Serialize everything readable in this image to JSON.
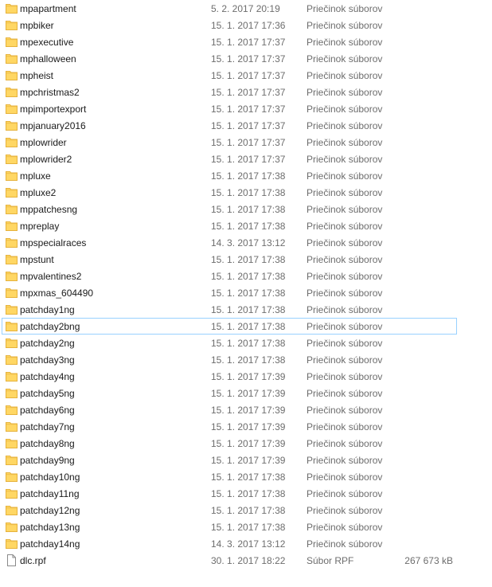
{
  "colors": {
    "folder_fill": "#ffd764",
    "folder_tab": "#e6b23c",
    "meta_text": "#6d6d6d",
    "focus_border": "#99d1ff"
  },
  "rows": [
    {
      "name": "mpapartment",
      "date": "5. 2. 2017 20:19",
      "type": "Priečinok súborov",
      "size": "",
      "icon": "folder-icon"
    },
    {
      "name": "mpbiker",
      "date": "15. 1. 2017 17:36",
      "type": "Priečinok súborov",
      "size": "",
      "icon": "folder-icon"
    },
    {
      "name": "mpexecutive",
      "date": "15. 1. 2017 17:37",
      "type": "Priečinok súborov",
      "size": "",
      "icon": "folder-icon"
    },
    {
      "name": "mphalloween",
      "date": "15. 1. 2017 17:37",
      "type": "Priečinok súborov",
      "size": "",
      "icon": "folder-icon"
    },
    {
      "name": "mpheist",
      "date": "15. 1. 2017 17:37",
      "type": "Priečinok súborov",
      "size": "",
      "icon": "folder-icon"
    },
    {
      "name": "mpchristmas2",
      "date": "15. 1. 2017 17:37",
      "type": "Priečinok súborov",
      "size": "",
      "icon": "folder-icon"
    },
    {
      "name": "mpimportexport",
      "date": "15. 1. 2017 17:37",
      "type": "Priečinok súborov",
      "size": "",
      "icon": "folder-icon"
    },
    {
      "name": "mpjanuary2016",
      "date": "15. 1. 2017 17:37",
      "type": "Priečinok súborov",
      "size": "",
      "icon": "folder-icon"
    },
    {
      "name": "mplowrider",
      "date": "15. 1. 2017 17:37",
      "type": "Priečinok súborov",
      "size": "",
      "icon": "folder-icon"
    },
    {
      "name": "mplowrider2",
      "date": "15. 1. 2017 17:37",
      "type": "Priečinok súborov",
      "size": "",
      "icon": "folder-icon"
    },
    {
      "name": "mpluxe",
      "date": "15. 1. 2017 17:38",
      "type": "Priečinok súborov",
      "size": "",
      "icon": "folder-icon"
    },
    {
      "name": "mpluxe2",
      "date": "15. 1. 2017 17:38",
      "type": "Priečinok súborov",
      "size": "",
      "icon": "folder-icon"
    },
    {
      "name": "mppatchesng",
      "date": "15. 1. 2017 17:38",
      "type": "Priečinok súborov",
      "size": "",
      "icon": "folder-icon"
    },
    {
      "name": "mpreplay",
      "date": "15. 1. 2017 17:38",
      "type": "Priečinok súborov",
      "size": "",
      "icon": "folder-icon"
    },
    {
      "name": "mpspecialraces",
      "date": "14. 3. 2017 13:12",
      "type": "Priečinok súborov",
      "size": "",
      "icon": "folder-icon"
    },
    {
      "name": "mpstunt",
      "date": "15. 1. 2017 17:38",
      "type": "Priečinok súborov",
      "size": "",
      "icon": "folder-icon"
    },
    {
      "name": "mpvalentines2",
      "date": "15. 1. 2017 17:38",
      "type": "Priečinok súborov",
      "size": "",
      "icon": "folder-icon"
    },
    {
      "name": "mpxmas_604490",
      "date": "15. 1. 2017 17:38",
      "type": "Priečinok súborov",
      "size": "",
      "icon": "folder-icon"
    },
    {
      "name": "patchday1ng",
      "date": "15. 1. 2017 17:38",
      "type": "Priečinok súborov",
      "size": "",
      "icon": "folder-icon"
    },
    {
      "name": "patchday2bng",
      "date": "15. 1. 2017 17:38",
      "type": "Priečinok súborov",
      "size": "",
      "icon": "folder-icon",
      "focused": true
    },
    {
      "name": "patchday2ng",
      "date": "15. 1. 2017 17:38",
      "type": "Priečinok súborov",
      "size": "",
      "icon": "folder-icon"
    },
    {
      "name": "patchday3ng",
      "date": "15. 1. 2017 17:38",
      "type": "Priečinok súborov",
      "size": "",
      "icon": "folder-icon"
    },
    {
      "name": "patchday4ng",
      "date": "15. 1. 2017 17:39",
      "type": "Priečinok súborov",
      "size": "",
      "icon": "folder-icon"
    },
    {
      "name": "patchday5ng",
      "date": "15. 1. 2017 17:39",
      "type": "Priečinok súborov",
      "size": "",
      "icon": "folder-icon"
    },
    {
      "name": "patchday6ng",
      "date": "15. 1. 2017 17:39",
      "type": "Priečinok súborov",
      "size": "",
      "icon": "folder-icon"
    },
    {
      "name": "patchday7ng",
      "date": "15. 1. 2017 17:39",
      "type": "Priečinok súborov",
      "size": "",
      "icon": "folder-icon"
    },
    {
      "name": "patchday8ng",
      "date": "15. 1. 2017 17:39",
      "type": "Priečinok súborov",
      "size": "",
      "icon": "folder-icon"
    },
    {
      "name": "patchday9ng",
      "date": "15. 1. 2017 17:39",
      "type": "Priečinok súborov",
      "size": "",
      "icon": "folder-icon"
    },
    {
      "name": "patchday10ng",
      "date": "15. 1. 2017 17:38",
      "type": "Priečinok súborov",
      "size": "",
      "icon": "folder-icon"
    },
    {
      "name": "patchday11ng",
      "date": "15. 1. 2017 17:38",
      "type": "Priečinok súborov",
      "size": "",
      "icon": "folder-icon"
    },
    {
      "name": "patchday12ng",
      "date": "15. 1. 2017 17:38",
      "type": "Priečinok súborov",
      "size": "",
      "icon": "folder-icon"
    },
    {
      "name": "patchday13ng",
      "date": "15. 1. 2017 17:38",
      "type": "Priečinok súborov",
      "size": "",
      "icon": "folder-icon"
    },
    {
      "name": "patchday14ng",
      "date": "14. 3. 2017 13:12",
      "type": "Priečinok súborov",
      "size": "",
      "icon": "folder-icon"
    },
    {
      "name": "dlc.rpf",
      "date": "30. 1. 2017 18:22",
      "type": "Súbor RPF",
      "size": "267 673 kB",
      "icon": "file-icon"
    }
  ]
}
